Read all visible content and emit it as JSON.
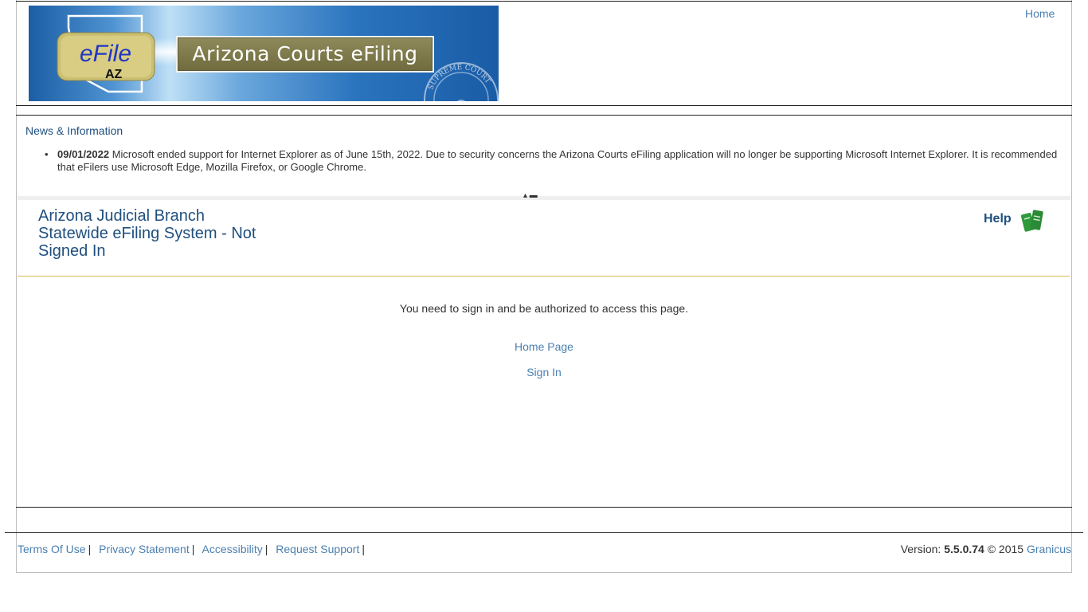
{
  "banner": {
    "logo_text": "eFile",
    "logo_sub": "AZ",
    "title": "Arizona Courts eFiling",
    "seal_text": "SUPREME COURT"
  },
  "top_nav": {
    "home_label": "Home"
  },
  "news": {
    "title": "News & Information",
    "items": [
      {
        "date": "09/01/2022",
        "text": "Microsoft ended support for Internet Explorer as of June 15th, 2022. Due to security concerns the Arizona Courts eFiling application will no longer be supporting Microsoft Internet Explorer. It is recommended that eFilers use Microsoft Edge, Mozilla Firefox, or Google Chrome."
      }
    ]
  },
  "system": {
    "title": "Arizona Judicial Branch Statewide eFiling System - Not Signed In",
    "help_label": "Help"
  },
  "main": {
    "message": "You need to sign in and be authorized to access this page.",
    "home_page_label": "Home Page",
    "sign_in_label": "Sign In"
  },
  "footer": {
    "links": [
      "Terms Of Use",
      "Privacy Statement",
      "Accessibility",
      "Request Support"
    ],
    "separator": "|",
    "version_label": "Version:",
    "version_number": "5.5.0.74",
    "copyright": "© 2015",
    "vendor": "Granicus"
  },
  "colors": {
    "link": "#4a7fb0",
    "heading": "#1f4f7f",
    "gold_rule": "#d8b84f",
    "help_green": "#2e9a3c"
  }
}
